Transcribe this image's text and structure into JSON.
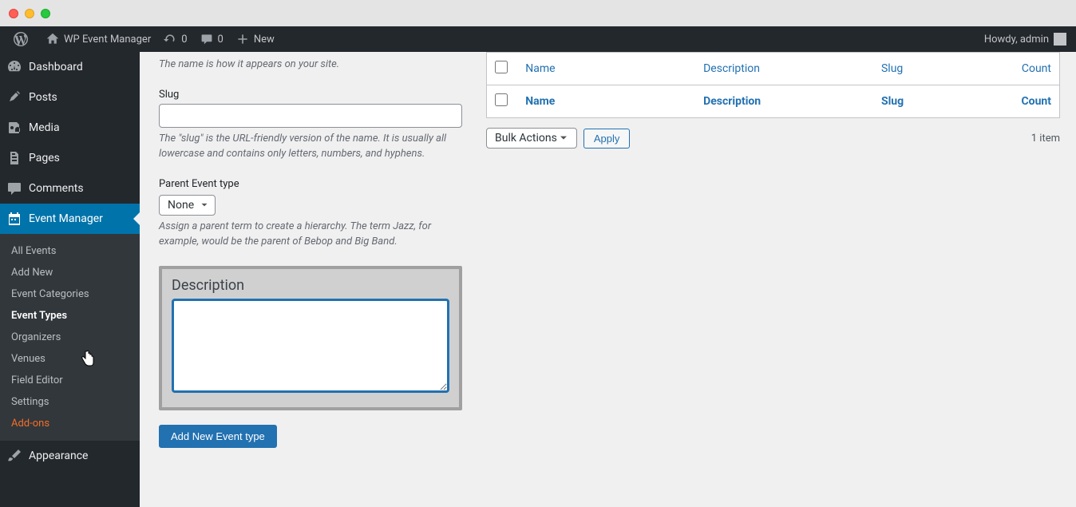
{
  "adminbar": {
    "site_title": "WP Event Manager",
    "updates_count": "0",
    "comments_count": "0",
    "new_label": "New",
    "howdy": "Howdy, admin"
  },
  "sidebar": {
    "items": [
      {
        "label": "Dashboard"
      },
      {
        "label": "Posts"
      },
      {
        "label": "Media"
      },
      {
        "label": "Pages"
      },
      {
        "label": "Comments"
      },
      {
        "label": "Event Manager"
      },
      {
        "label": "Appearance"
      }
    ],
    "submenu": [
      {
        "label": "All Events"
      },
      {
        "label": "Add New"
      },
      {
        "label": "Event Categories"
      },
      {
        "label": "Event Types"
      },
      {
        "label": "Organizers"
      },
      {
        "label": "Venues"
      },
      {
        "label": "Field Editor"
      },
      {
        "label": "Settings"
      },
      {
        "label": "Add-ons"
      }
    ]
  },
  "form": {
    "name_help": "The name is how it appears on your site.",
    "slug_label": "Slug",
    "slug_help": "The \"slug\" is the URL-friendly version of the name. It is usually all lowercase and contains only letters, numbers, and hyphens.",
    "parent_label": "Parent Event type",
    "parent_value": "None",
    "parent_help": "Assign a parent term to create a hierarchy. The term Jazz, for example, would be the parent of Bebop and Big Band.",
    "description_label": "Description",
    "submit_label": "Add New Event type"
  },
  "table": {
    "cols": {
      "name": "Name",
      "description": "Description",
      "slug": "Slug",
      "count": "Count"
    },
    "bulk_label": "Bulk Actions",
    "apply_label": "Apply",
    "item_count": "1 item"
  }
}
